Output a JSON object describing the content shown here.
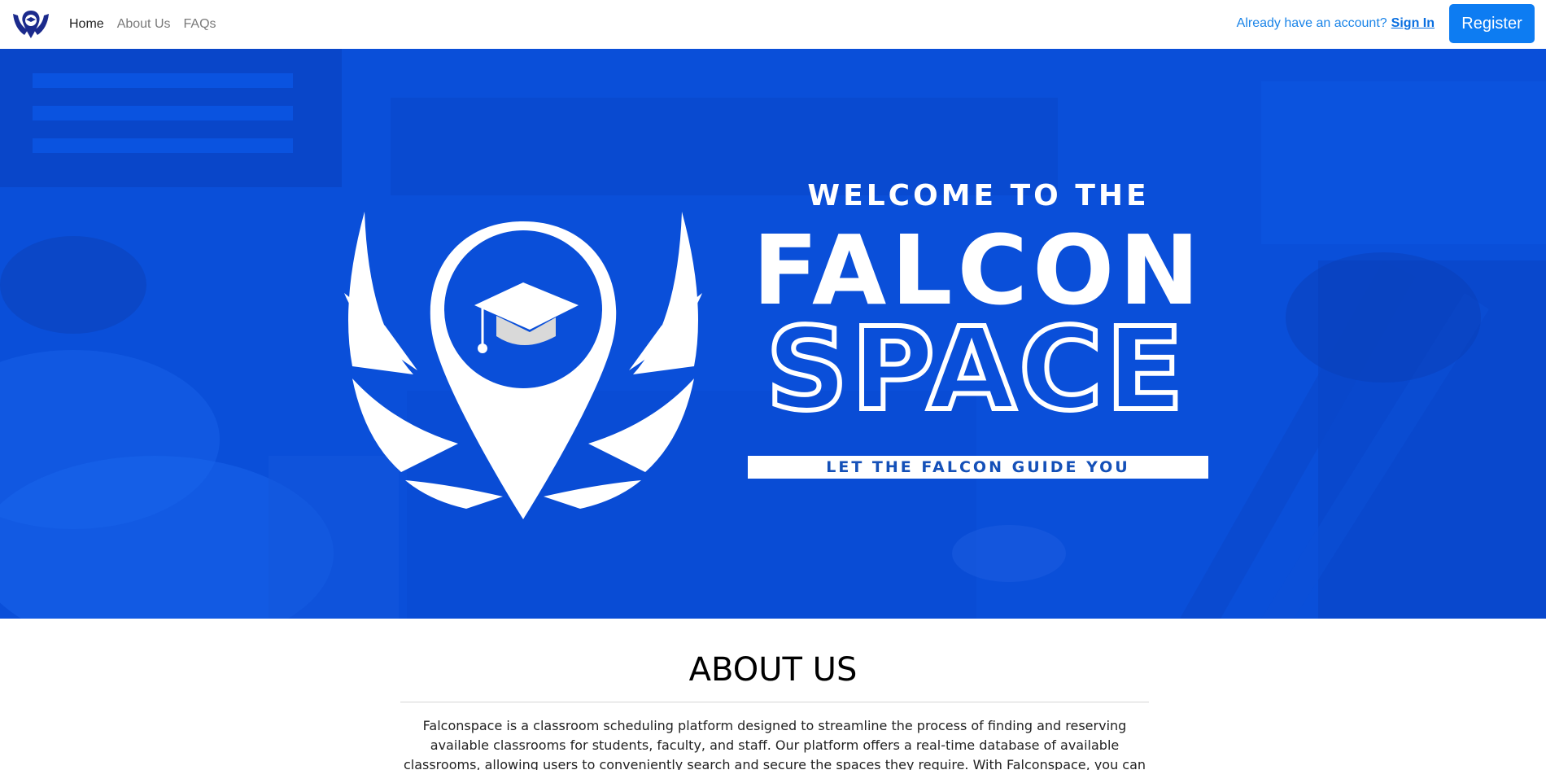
{
  "navbar": {
    "brand_icon": "falcon-pin-logo-icon",
    "links": [
      {
        "label": "Home",
        "active": true
      },
      {
        "label": "About Us",
        "active": false
      },
      {
        "label": "FAQs",
        "active": false
      }
    ],
    "account_prompt": "Already have an account?",
    "signin_label": "Sign In",
    "register_label": "Register"
  },
  "hero": {
    "welcome": "WELCOME TO THE",
    "falcon": "FALCON",
    "space": "SPACE",
    "tagline": "LET THE FALCON GUIDE YOU",
    "logo_icon": "falcon-wings-graduation-cap-icon"
  },
  "about": {
    "title": "ABOUT US",
    "body": "Falconspace is a classroom scheduling platform designed to streamline the process of finding and reserving available classrooms for students, faculty, and staff. Our platform offers a real-time database of available classrooms, allowing users to conveniently search and secure the spaces they require. With Falconspace, you can easily access up-to-date information on classroom"
  },
  "colors": {
    "brand_blue": "#0a4fd9",
    "navy": "#1b2a8c",
    "link_blue": "#1a84e8",
    "button_blue": "#0d7cf2"
  }
}
